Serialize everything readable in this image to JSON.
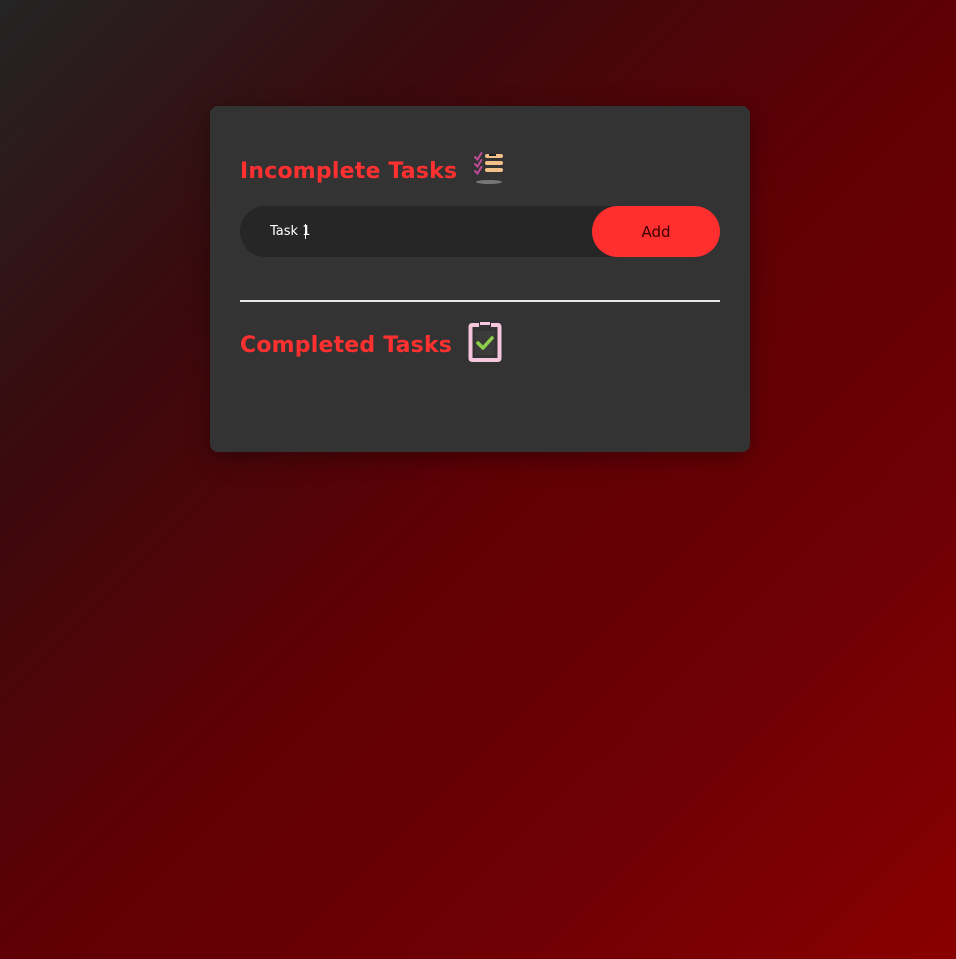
{
  "incomplete": {
    "title": "Incomplete Tasks",
    "icon": "checklist-icon",
    "items": []
  },
  "form": {
    "input_value": "Task 1",
    "add_label": "Add"
  },
  "completed": {
    "title": "Completed Tasks",
    "icon": "clipboard-check-icon",
    "items": []
  },
  "colors": {
    "accent": "#ff3030",
    "card": "#333333",
    "input_bg": "#262626",
    "button": "#ff2f2f"
  }
}
